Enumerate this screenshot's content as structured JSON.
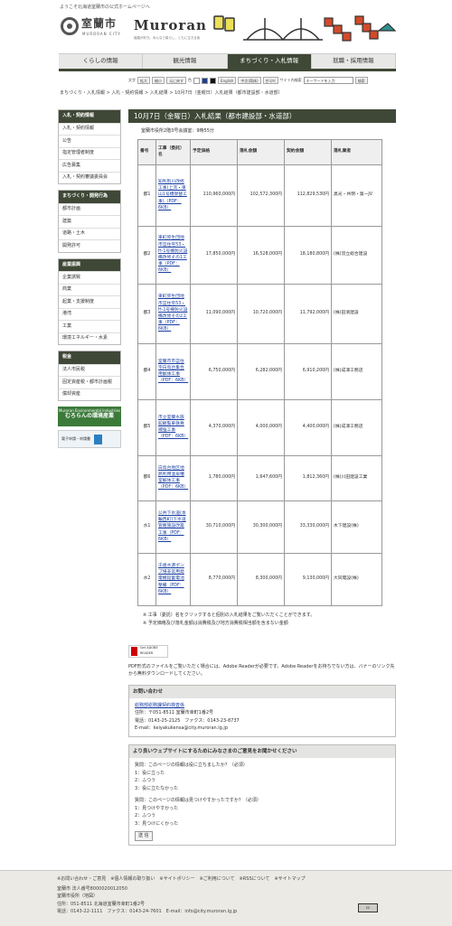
{
  "header": {
    "welcome": "ようこそ北海道室蘭市の公式ホームページへ",
    "city_name": "室蘭市",
    "city_sub": "MURORAN CITY",
    "brand": "Muroran",
    "tagline": "複雑が好き。みんなで暮らし、ともに生きる街"
  },
  "nav": {
    "tabs": [
      "くらしの情報",
      "観光情報",
      "まちづくり・入札情報",
      "就職・採用情報"
    ],
    "active": 2
  },
  "tools": {
    "font_label": "文字",
    "enlarge": "拡大",
    "shrink": "縮小",
    "reset": "元に戻す",
    "color_label": "色",
    "lang_en": "English",
    "lang_zh": "中文(简体)",
    "lang_ko": "한국어",
    "search_label": "サイト内検索",
    "search_placeholder": "キーワードを入力",
    "search_button": "検索"
  },
  "breadcrumb": "まちづくり・入札情報 > 入札・契約情報 > 入札結果 > 10月7日（金曜日）入札結果（都市建設部・水道部）",
  "sidebar": {
    "groups": [
      {
        "title": "入札・契約情報",
        "items": [
          "入札・契約情報",
          "公告",
          "指定管理者制度",
          "広告募集",
          "入札・契約審議委員会"
        ]
      },
      {
        "title": "まちづくり・開発行為",
        "items": [
          "都市計画",
          "建築",
          "道路・土木",
          "開発許可"
        ]
      },
      {
        "title": "産業振興",
        "items": [
          "企業誘致",
          "商業",
          "起業・支援制度",
          "港湾",
          "工業",
          "環境エネルギー・水素"
        ]
      },
      {
        "title": "税金",
        "items": [
          "法人市民税",
          "固定資産税・都市計画税",
          "償却資産"
        ]
      }
    ],
    "banner1_top": "Muroran Environmental Industries",
    "banner1_main": "むろらんの環境産業",
    "banner2": "電子申請・申請書"
  },
  "main": {
    "title": "10月7日（金曜日）入札結果（都市建設部・水道部）",
    "venue": "室蘭市役所2階3号会議室：9時55分",
    "headers": [
      "番号",
      "工事（委託）名",
      "予定価格",
      "落札金額",
      "契約金額",
      "落札業者"
    ],
    "rows": [
      {
        "no": "都1",
        "name": "知利別川改修工事(仮称)上流その1",
        "name_disp": "知利別川改修工事(上流・東山1号橋架替工事)（PDF：6KB）",
        "price": "110,960,000円",
        "bid": "102,572,300円",
        "contract": "112,829,530円",
        "winner": "黒光・共明・第一JV"
      },
      {
        "no": "都2",
        "name": "",
        "name_disp": "東町弥生団地市営住宅53・H-1号棟防火設備改修その1工事（PDF：6KB）",
        "price": "17,850,000円",
        "bid": "16,528,000円",
        "contract": "18,180,800円",
        "winner": "(株)羽立総合建設"
      },
      {
        "no": "都3",
        "name": "",
        "name_disp": "東町弥生団地市営住宅53・H-1号棟防火設備改修その2工事（PDF：6KB）",
        "price": "11,090,000円",
        "bid": "10,720,000円",
        "contract": "11,792,000円",
        "winner": "(株)田渕建設"
      },
      {
        "no": "都4",
        "name": "",
        "name_disp": "室蘭市市営住宅白鳥台集合用解体工事（PDF：6KB）",
        "price": "6,750,000円",
        "bid": "6,282,000円",
        "contract": "6,910,200円",
        "winner": "(株)成澤工務店"
      },
      {
        "no": "都5",
        "name": "",
        "name_disp": "市立室蘭水族館観覧車鉄骨補強工事（PDF：6KB）",
        "price": "4,370,000円",
        "bid": "4,000,000円",
        "contract": "4,400,000円",
        "winner": "(株)成澤工務店"
      },
      {
        "no": "都6",
        "name": "",
        "name_disp": "白鳥台地区地熱利用温泉槽室解体工事（PDF：6KB）",
        "price": "1,780,000円",
        "bid": "1,647,600円",
        "contract": "1,812,360円",
        "winner": "(株)川田建設工業"
      },
      {
        "no": "水1",
        "name": "",
        "name_disp": "公共下水道(本輪西町)下水道管路施設改築工事（PDF：6KB）",
        "price": "30,710,000円",
        "bid": "30,300,000円",
        "contract": "33,330,000円",
        "winner": "木下建設(株)"
      },
      {
        "no": "水2",
        "name": "",
        "name_disp": "千歳水源ポンプ場非常用発電機鉛蓄電池整備（PDF：6KB）",
        "price": "8,770,000円",
        "bid": "8,300,000円",
        "contract": "9,130,000円",
        "winner": "大同電設(株)"
      }
    ],
    "notes": [
      "※ 工事（委託）名をクリックすると個別の入札結果をご覧いただくことができます。",
      "※ 予定価格及び落札金額は消費税及び地方消費税相当額を含まない金額"
    ],
    "pdf_badge": "Get ADOBE READER",
    "pdf_text": "PDF形式のファイルをご覧いただく場合には、Adobe Readerが必要です。Adobe Readerをお持ちでない方は、バナーのリンク先から無料ダウンロードしてください。",
    "contact": {
      "title": "お問い合わせ",
      "dept": "総務部総務課契約検査係",
      "address": "住所：〒051-8511 室蘭市幸町1番2号",
      "phone": "電話：0143-25-2125　ファクス：0143-23-8737",
      "email": "E-mail：keiyakukensa@city.muroran.lg.jp"
    },
    "survey": {
      "title": "より良いウェブサイトにするためにみなさまのご意見をお聞かせください",
      "q1": "質問：このページの情報は役に立ちましたか？（必須）",
      "q1_opts": [
        "1：役に立った",
        "2：ふつう",
        "3：役に立たなかった"
      ],
      "q2": "質問：このページの情報は見つけやすかったですか？（必須）",
      "q2_opts": [
        "1：見つけやすかった",
        "2：ふつう",
        "3：見つけにくかった"
      ],
      "submit": "送 信"
    }
  },
  "footer": {
    "links": "※お問い合わせ・ご意見　※個人情報の取り扱い　※サイトポリシー　※ご利用について　※RSSについて　※サイトマップ",
    "corp": "室蘭市 法人番号8000020012050",
    "office": "室蘭市役所（地図）",
    "address": "住所：051-8511 北海道室蘭市幸町1番2号",
    "contact": "電話：0143-22-1111　ファクス：0143-24-7601　E-mail：info@city.muroran.lg.jp",
    "cc": "cc"
  }
}
